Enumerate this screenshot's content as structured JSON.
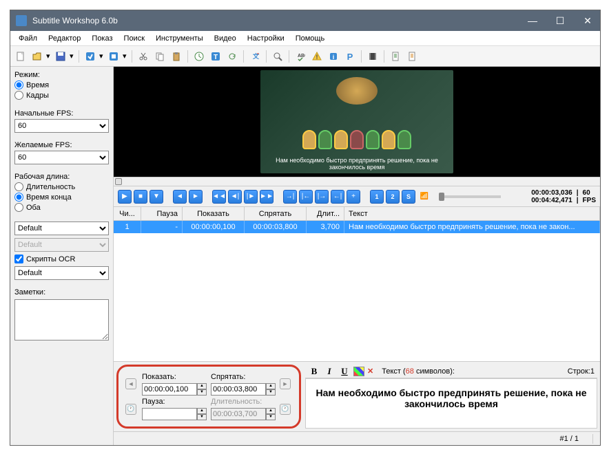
{
  "title": "Subtitle Workshop 6.0b",
  "menu": {
    "file": "Файл",
    "editor": "Редактор",
    "show": "Показ",
    "search": "Поиск",
    "tools": "Инструменты",
    "video": "Видео",
    "settings": "Настройки",
    "help": "Помощь"
  },
  "sidebar": {
    "mode_label": "Режим:",
    "mode_time": "Время",
    "mode_frames": "Кадры",
    "start_fps_label": "Начальные FPS:",
    "start_fps": "60",
    "target_fps_label": "Желаемые FPS:",
    "target_fps": "60",
    "work_len_label": "Рабочая длина:",
    "dur_opt": "Длительность",
    "end_opt": "Время конца",
    "both_opt": "Оба",
    "default1": "Default",
    "default2": "Default",
    "ocr_label": "Скрипты OCR",
    "default3": "Default",
    "notes_label": "Заметки:"
  },
  "video": {
    "subtitle_overlay": "Нам необходимо быстро предпринять решение, пока не закончилось время",
    "time_current": "00:00:03,036",
    "time_total": "00:04:42,471",
    "fps_num": "60",
    "fps_label": "FPS"
  },
  "grid": {
    "h_num": "Чи...",
    "h_pause": "Пауза",
    "h_show": "Показать",
    "h_hide": "Спрятать",
    "h_dur": "Длит...",
    "h_text": "Текст",
    "rows": [
      {
        "num": "1",
        "pause": "-",
        "show": "00:00:00,100",
        "hide": "00:00:03,800",
        "dur": "3,700",
        "text": "Нам необходимо быстро предпринять решение, пока не закон..."
      }
    ]
  },
  "editor": {
    "show_label": "Показать:",
    "show_val": "00:00:00,100",
    "hide_label": "Спрятать:",
    "hide_val": "00:00:03,800",
    "pause_label": "Пауза:",
    "pause_val": "",
    "dur_label": "Длительность:",
    "dur_val": "00:00:03,700",
    "text_label": "Текст (",
    "char_count": "68",
    "text_label2": " символов):",
    "line_label": "Строк:",
    "line_count": "1",
    "text": "Нам необходимо быстро предпринять решение, пока не закончилось время"
  },
  "status": {
    "page": "#1 / 1"
  }
}
